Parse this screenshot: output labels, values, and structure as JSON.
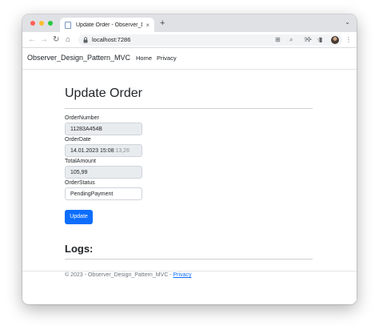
{
  "browser": {
    "tab_title": "Update Order - Observer_Desi",
    "tab_close": "×",
    "new_tab": "+",
    "tab_menu": "⌄",
    "url": "localhost:7286",
    "back": "←",
    "forward": "→",
    "reload": "↻",
    "home": "⌂"
  },
  "navbar": {
    "brand": "Observer_Design_Pattern_MVC",
    "links": [
      "Home",
      "Privacy"
    ]
  },
  "form": {
    "title": "Update Order",
    "fields": [
      {
        "label": "OrderNumber",
        "value": "11283A454B"
      },
      {
        "label": "OrderDate",
        "value": "14.01.2023 15:08",
        "value_rest": ":13,26"
      },
      {
        "label": "TotalAmount",
        "value": "105,99"
      },
      {
        "label": "OrderStatus",
        "value": "PendingPayment"
      }
    ],
    "submit_label": "Update"
  },
  "logs": {
    "title": "Logs:"
  },
  "footer": {
    "text": "© 2023 - Observer_Design_Pattern_MVC - ",
    "link": "Privacy"
  }
}
